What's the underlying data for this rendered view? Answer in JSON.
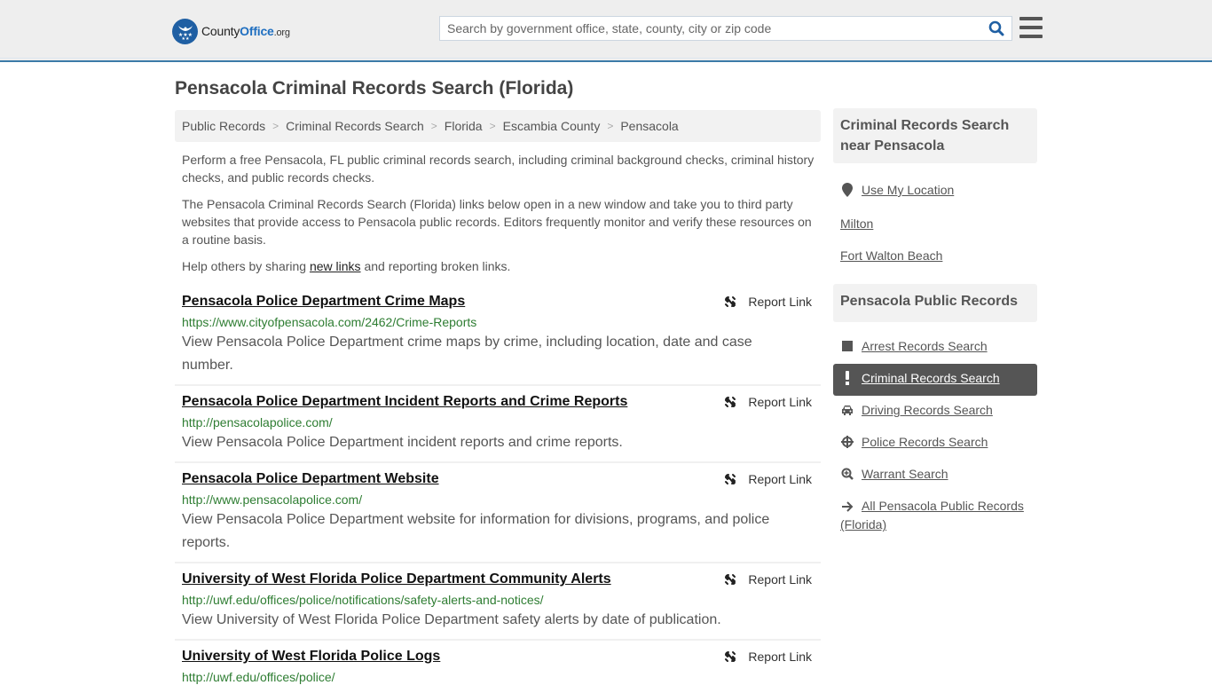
{
  "header": {
    "logo": {
      "county": "County",
      "office": "Office",
      "org": ".org"
    },
    "search_placeholder": "Search by government office, state, county, city or zip code",
    "search_value": "",
    "colors": {
      "accent": "#3c7ba8",
      "logo_blue": "#1f5fa3"
    }
  },
  "page_title": "Pensacola Criminal Records Search (Florida)",
  "breadcrumb": [
    "Public Records",
    "Criminal Records Search",
    "Florida",
    "Escambia County",
    "Pensacola"
  ],
  "intro": {
    "p1": "Perform a free Pensacola, FL public criminal records search, including criminal background checks, criminal history checks, and public records checks.",
    "p2": "The Pensacola Criminal Records Search (Florida) links below open in a new window and take you to third party websites that provide access to Pensacola public records. Editors frequently monitor and verify these resources on a routine basis.",
    "p3_before": "Help others by sharing ",
    "p3_link": "new links",
    "p3_after": " and reporting broken links."
  },
  "report_label": "Report Link",
  "results": [
    {
      "title": "Pensacola Police Department Crime Maps",
      "url": "https://www.cityofpensacola.com/2462/Crime-Reports",
      "desc": "View Pensacola Police Department crime maps by crime, including location, date and case number."
    },
    {
      "title": "Pensacola Police Department Incident Reports and Crime Reports",
      "url": "http://pensacolapolice.com/",
      "desc": "View Pensacola Police Department incident reports and crime reports."
    },
    {
      "title": "Pensacola Police Department Website",
      "url": "http://www.pensacolapolice.com/",
      "desc": "View Pensacola Police Department website for information for divisions, programs, and police reports."
    },
    {
      "title": "University of West Florida Police Department Community Alerts",
      "url": "http://uwf.edu/offices/police/notifications/safety-alerts-and-notices/",
      "desc": "View University of West Florida Police Department safety alerts by date of publication."
    },
    {
      "title": "University of West Florida Police Logs",
      "url": "http://uwf.edu/offices/police/",
      "desc": ""
    }
  ],
  "sidebar": {
    "nearby": {
      "heading": "Criminal Records Search near Pensacola",
      "use_location": "Use My Location",
      "cities": [
        "Milton",
        "Fort Walton Beach"
      ]
    },
    "public_records": {
      "heading": "Pensacola Public Records",
      "items": [
        {
          "label": "Arrest Records Search",
          "icon": "square-icon",
          "active": false
        },
        {
          "label": "Criminal Records Search",
          "icon": "exclamation-icon",
          "active": true
        },
        {
          "label": "Driving Records Search",
          "icon": "car-icon",
          "active": false
        },
        {
          "label": "Police Records Search",
          "icon": "crosshairs-icon",
          "active": false
        },
        {
          "label": "Warrant Search",
          "icon": "zoom-in-icon",
          "active": false
        },
        {
          "label": "All Pensacola Public Records (Florida)",
          "icon": "arrow-right-icon",
          "active": false
        }
      ]
    }
  }
}
